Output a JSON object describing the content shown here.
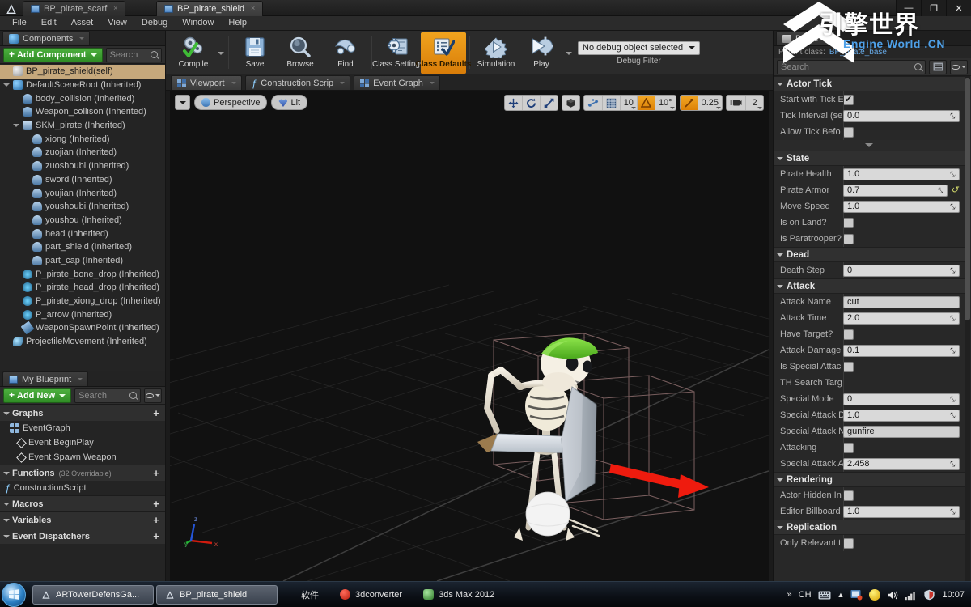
{
  "window": {
    "doc_tabs": [
      {
        "label": "BP_pirate_scarf",
        "active": false
      },
      {
        "label": "BP_pirate_shield",
        "active": true
      }
    ],
    "controls": {
      "minimize": "—",
      "maximize": "❐",
      "close": "✕"
    }
  },
  "menubar": {
    "items": [
      "File",
      "Edit",
      "Asset",
      "View",
      "Debug",
      "Window",
      "Help"
    ]
  },
  "components": {
    "tab_label": "Components",
    "add_button": "Add Component",
    "search_placeholder": "Search",
    "tree": [
      {
        "label": "BP_pirate_shield(self)",
        "indent": 0,
        "icon": "blueprint-self",
        "selected": true,
        "arrow": "none"
      },
      {
        "label": "DefaultSceneRoot (Inherited)",
        "indent": 0,
        "icon": "scene",
        "selected": false,
        "arrow": "open"
      },
      {
        "label": "body_collision (Inherited)",
        "indent": 1,
        "icon": "capsule",
        "selected": false,
        "arrow": "none"
      },
      {
        "label": "Weapon_collison (Inherited)",
        "indent": 1,
        "icon": "capsule",
        "selected": false,
        "arrow": "none"
      },
      {
        "label": "SKM_pirate (Inherited)",
        "indent": 1,
        "icon": "skmesh",
        "selected": false,
        "arrow": "open"
      },
      {
        "label": "xiong (Inherited)",
        "indent": 2,
        "icon": "socket",
        "selected": false,
        "arrow": "none"
      },
      {
        "label": "zuojian (Inherited)",
        "indent": 2,
        "icon": "socket",
        "selected": false,
        "arrow": "none"
      },
      {
        "label": "zuoshoubi (Inherited)",
        "indent": 2,
        "icon": "socket",
        "selected": false,
        "arrow": "none"
      },
      {
        "label": "sword (Inherited)",
        "indent": 2,
        "icon": "socket",
        "selected": false,
        "arrow": "none"
      },
      {
        "label": "youjian (Inherited)",
        "indent": 2,
        "icon": "socket",
        "selected": false,
        "arrow": "none"
      },
      {
        "label": "youshoubi (Inherited)",
        "indent": 2,
        "icon": "socket",
        "selected": false,
        "arrow": "none"
      },
      {
        "label": "youshou (Inherited)",
        "indent": 2,
        "icon": "socket",
        "selected": false,
        "arrow": "none"
      },
      {
        "label": "head (Inherited)",
        "indent": 2,
        "icon": "socket",
        "selected": false,
        "arrow": "none"
      },
      {
        "label": "part_shield (Inherited)",
        "indent": 2,
        "icon": "socket",
        "selected": false,
        "arrow": "none"
      },
      {
        "label": "part_cap (Inherited)",
        "indent": 2,
        "icon": "socket",
        "selected": false,
        "arrow": "none"
      },
      {
        "label": "P_pirate_bone_drop (Inherited)",
        "indent": 1,
        "icon": "particle",
        "selected": false,
        "arrow": "none"
      },
      {
        "label": "P_pirate_head_drop (Inherited)",
        "indent": 1,
        "icon": "particle",
        "selected": false,
        "arrow": "none"
      },
      {
        "label": "P_pirate_xiong_drop (Inherited)",
        "indent": 1,
        "icon": "particle",
        "selected": false,
        "arrow": "none"
      },
      {
        "label": "P_arrow (Inherited)",
        "indent": 1,
        "icon": "particle",
        "selected": false,
        "arrow": "none"
      },
      {
        "label": "WeaponSpawnPoint (Inherited)",
        "indent": 1,
        "icon": "arrowc",
        "selected": false,
        "arrow": "none"
      },
      {
        "label": "ProjectileMovement (Inherited)",
        "indent": 0,
        "icon": "projm",
        "selected": false,
        "arrow": "none"
      }
    ]
  },
  "my_blueprint": {
    "tab_label": "My Blueprint",
    "add_button": "Add New",
    "search_placeholder": "Search",
    "sections": [
      {
        "title": "Graphs",
        "sub": "",
        "add": "+",
        "rows": [
          {
            "label": "EventGraph",
            "icon": "graph",
            "indent": 0
          },
          {
            "label": "Event BeginPlay",
            "icon": "diamond",
            "indent": 1
          },
          {
            "label": "Event Spawn Weapon",
            "icon": "diamond",
            "indent": 1
          }
        ]
      },
      {
        "title": "Functions",
        "sub": "(32 Overridable)",
        "add": "+",
        "rows": [
          {
            "label": "ConstructionScript",
            "icon": "function",
            "indent": 0
          }
        ]
      },
      {
        "title": "Macros",
        "sub": "",
        "add": "+",
        "rows": []
      },
      {
        "title": "Variables",
        "sub": "",
        "add": "+",
        "rows": []
      },
      {
        "title": "Event Dispatchers",
        "sub": "",
        "add": "+",
        "rows": []
      }
    ]
  },
  "toolbar": {
    "buttons": [
      {
        "label": "Compile",
        "icon": "compile-icon",
        "has_caret": true,
        "active": false
      },
      {
        "label": "Save",
        "icon": "save-icon",
        "has_caret": false,
        "active": false
      },
      {
        "label": "Browse",
        "icon": "browse-icon",
        "has_caret": false,
        "active": false
      },
      {
        "label": "Find",
        "icon": "find-icon",
        "has_caret": false,
        "active": false
      },
      {
        "label": "Class Settings",
        "icon": "class-settings-icon",
        "has_caret": false,
        "active": false
      },
      {
        "label": "Class Defaults",
        "icon": "class-defaults-icon",
        "has_caret": false,
        "active": true
      },
      {
        "label": "Simulation",
        "icon": "simulation-icon",
        "has_caret": false,
        "active": false
      },
      {
        "label": "Play",
        "icon": "play-icon",
        "has_caret": true,
        "active": false
      }
    ],
    "debug_combo_value": "No debug object selected",
    "debug_filter_label": "Debug Filter"
  },
  "center_tabs": [
    {
      "label": "Viewport",
      "icon": "viewport-icon",
      "active": true
    },
    {
      "label": "Construction Scrip",
      "icon": "function-icon",
      "active": false
    },
    {
      "label": "Event Graph",
      "icon": "graph-icon",
      "active": false
    }
  ],
  "viewport": {
    "view_mode": "Perspective",
    "lighting_mode": "Lit",
    "transform_tools": [
      "translate-gizmo-icon",
      "rotate-gizmo-icon",
      "scale-gizmo-icon"
    ],
    "coord_space": "world-space-icon",
    "snap": {
      "surface_snap": "surface-snap-icon",
      "grid_snap_enabled": true,
      "grid_snap_value": "10",
      "angle_snap_enabled": true,
      "angle_snap_value": "10°",
      "scale_snap_enabled": true,
      "scale_snap_value": "0.25",
      "camera_speed_value": "2"
    },
    "axis_labels": {
      "x": "x",
      "y": "y",
      "z": "z"
    }
  },
  "details": {
    "tab_label": "Detail",
    "parent_class_label": "Parent class:",
    "parent_class_value": "BP_pirate_base",
    "search_placeholder": "Search",
    "categories": [
      {
        "name": "Actor Tick",
        "properties": [
          {
            "label": "Start with Tick E",
            "type": "checkbox",
            "checked": true
          },
          {
            "label": "Tick Interval (se",
            "type": "number",
            "value": "0.0"
          },
          {
            "label": "Allow Tick Befo",
            "type": "checkbox",
            "checked": false
          }
        ],
        "has_expander": true
      },
      {
        "name": "State",
        "properties": [
          {
            "label": "Pirate Health",
            "type": "number",
            "value": "1.0"
          },
          {
            "label": "Pirate Armor",
            "type": "number",
            "value": "0.7",
            "revert": true
          },
          {
            "label": "Move Speed",
            "type": "number",
            "value": "1.0"
          },
          {
            "label": "Is on Land?",
            "type": "checkbox",
            "checked": false
          },
          {
            "label": "Is Paratrooper?",
            "type": "checkbox",
            "checked": false
          }
        ],
        "has_expander": false
      },
      {
        "name": "Dead",
        "properties": [
          {
            "label": "Death Step",
            "type": "number",
            "value": "0"
          }
        ],
        "has_expander": false
      },
      {
        "name": "Attack",
        "properties": [
          {
            "label": "Attack Name",
            "type": "text",
            "value": "cut"
          },
          {
            "label": "Attack Time",
            "type": "number",
            "value": "2.0"
          },
          {
            "label": "Have Target?",
            "type": "checkbox",
            "checked": false
          },
          {
            "label": "Attack Damage",
            "type": "number",
            "value": "0.1"
          },
          {
            "label": "Is Special Attac",
            "type": "checkbox",
            "checked": false
          },
          {
            "label": "TH Search Targ",
            "type": "empty",
            "value": ""
          },
          {
            "label": "Special Mode",
            "type": "number",
            "value": "0"
          },
          {
            "label": "Special Attack D",
            "type": "number",
            "value": "1.0"
          },
          {
            "label": "Special Attack N",
            "type": "text",
            "value": "gunfire"
          },
          {
            "label": "Attacking",
            "type": "checkbox",
            "checked": false
          },
          {
            "label": "Special Attack A",
            "type": "number",
            "value": "2.458"
          }
        ],
        "has_expander": false
      },
      {
        "name": "Rendering",
        "properties": [
          {
            "label": "Actor Hidden In",
            "type": "checkbox",
            "checked": false
          },
          {
            "label": "Editor Billboard",
            "type": "number",
            "value": "1.0"
          }
        ],
        "has_expander": false
      },
      {
        "name": "Replication",
        "properties": [
          {
            "label": "Only Relevant t",
            "type": "checkbox",
            "checked": false
          }
        ],
        "has_expander": false
      }
    ]
  },
  "watermark": {
    "cn": "引擎世界",
    "en": "Engine World .CN"
  },
  "taskbar": {
    "start_icon": "windows-start-orb",
    "tasks": [
      {
        "label": "ARTowerDefensGa...",
        "icon": "ue-icon"
      },
      {
        "label": "BP_pirate_shield",
        "icon": "ue-icon"
      }
    ],
    "tray_left": [
      {
        "label": "软件",
        "icon": "none"
      },
      {
        "label": "3dconverter",
        "icon": "red-dot-icon"
      },
      {
        "label": "3ds Max 2012",
        "icon": "max-icon"
      }
    ],
    "tray_right": {
      "overflow": "»",
      "ime": "CH",
      "keyboard_icon": "keyboard-icon",
      "arrow_icon": "show-hidden-icon",
      "clock": "10:07"
    }
  },
  "colors": {
    "accent_orange": "#e8901a",
    "green_button": "#3d9a30",
    "selection_tan": "#c6a87c",
    "link_blue": "#67a9e6",
    "panel_bg": "#282828"
  }
}
